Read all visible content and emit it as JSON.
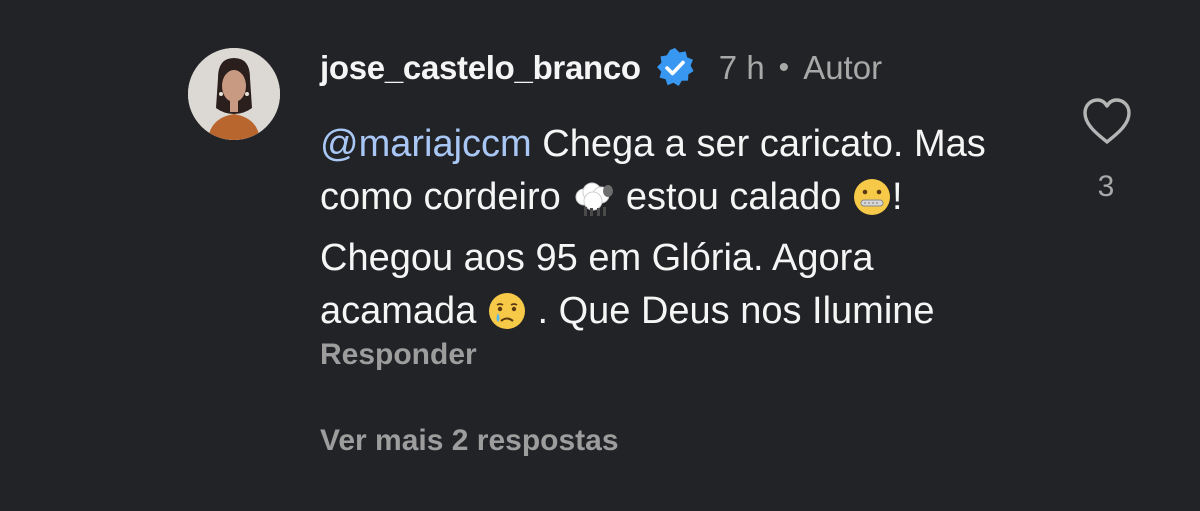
{
  "comment": {
    "username": "jose_castelo_branco",
    "verified_icon": "verified-badge-icon",
    "time": "7 h",
    "separator": "•",
    "author_label": "Autor",
    "mention": "@mariajccm",
    "text_part1": " Chega a ser caricato. Mas como cordeiro ",
    "text_part2": " estou calado ",
    "text_part3": "! Chegou aos 95 em Glória. Agora acamada ",
    "text_part4": " . Que Deus nos Ilumine",
    "emojis": [
      "sheep-emoji",
      "zipper-mouth-face-emoji",
      "sad-tear-face-emoji"
    ],
    "reply_label": "Responder",
    "view_more_label": "Ver mais 2 respostas",
    "like_icon": "heart-outline-icon",
    "like_count": "3"
  },
  "colors": {
    "background": "#222327",
    "mention": "#a9c7f5",
    "muted": "#a8a8a8",
    "verified": "#3897f0"
  }
}
